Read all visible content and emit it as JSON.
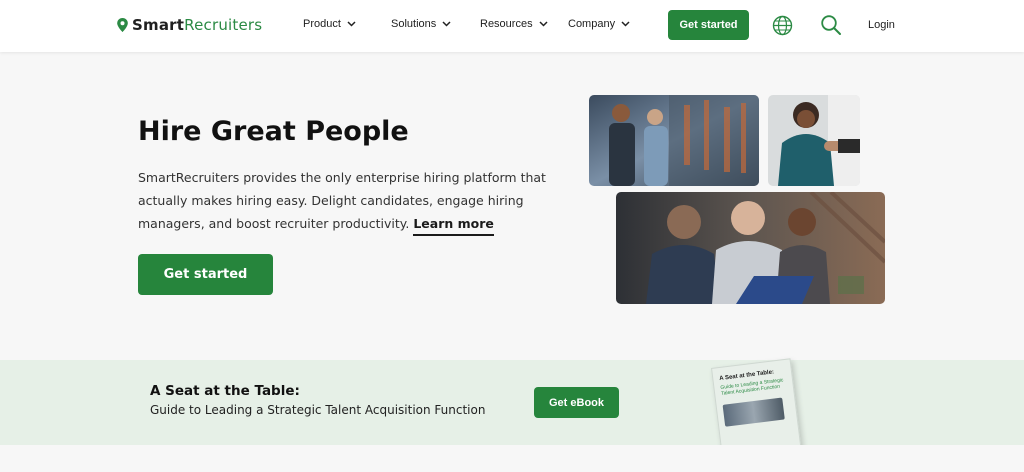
{
  "header": {
    "logo": {
      "smart": "Smart",
      "recruiters": "Recruiters"
    },
    "nav": [
      {
        "label": "Product"
      },
      {
        "label": "Solutions"
      },
      {
        "label": "Resources"
      },
      {
        "label": "Company"
      }
    ],
    "cta_label": "Get started",
    "login_label": "Login",
    "icons": [
      "map-pin-icon",
      "chevron-down-icon",
      "globe-icon",
      "search-icon"
    ]
  },
  "hero": {
    "title": "Hire Great People",
    "description": "SmartRecruiters provides the only enterprise hiring platform that actually makes hiring easy. Delight candidates, engage hiring managers, and boost recruiter productivity.",
    "learn_more": "Learn more",
    "cta_label": "Get started"
  },
  "banner": {
    "title": "A Seat at the Table:",
    "subtitle": "Guide to Leading a Strategic Talent Acquisition Function",
    "cta_label": "Get eBook",
    "book": {
      "title": "A Seat at the Table:",
      "subtitle": "Guide to Leading a Strategic Talent Acquisition Function"
    }
  },
  "colors": {
    "brand_green": "#26853c",
    "banner_bg": "#e6f0e7",
    "page_bg": "#f7f7f7"
  }
}
